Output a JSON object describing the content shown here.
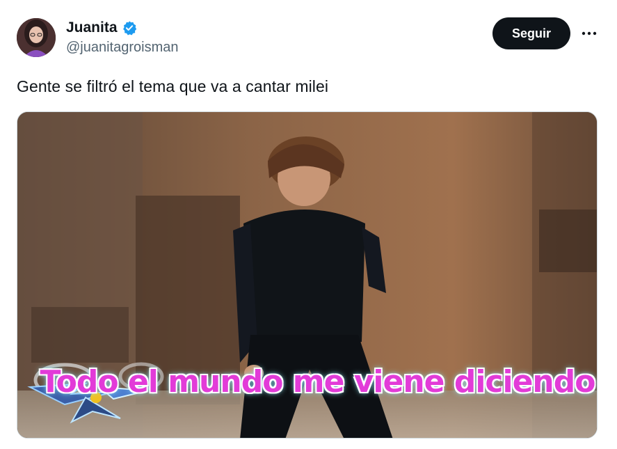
{
  "author": {
    "display_name": "Juanita",
    "handle": "@juanitagroisman",
    "verified": true
  },
  "actions": {
    "follow_label": "Seguir",
    "more_icon": "more-horizontal-icon"
  },
  "tweet": {
    "text": "Gente se filtró el tema que va a cantar milei"
  },
  "media": {
    "caption": "Todo el mundo me viene diciendo"
  },
  "colors": {
    "text_primary": "#0f1419",
    "text_secondary": "#536471",
    "verified_blue": "#1d9bf0",
    "follow_bg": "#0f1419",
    "caption_magenta": "#e23bd8"
  }
}
